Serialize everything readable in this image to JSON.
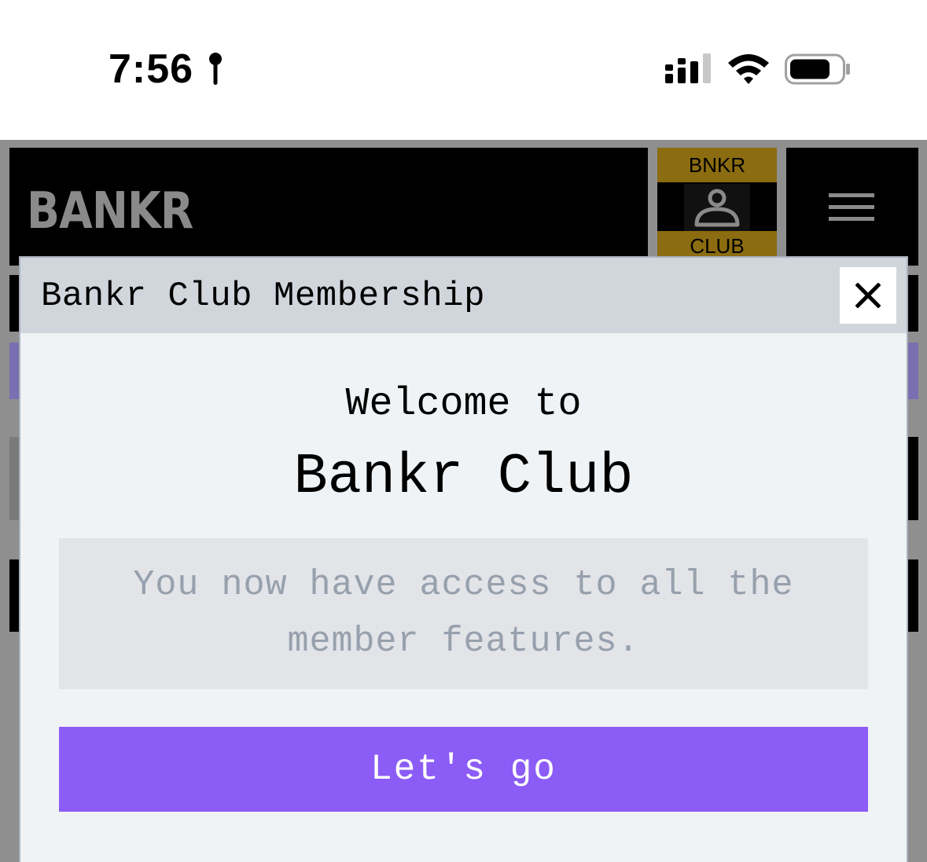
{
  "status_bar": {
    "time": "7:56",
    "icons": [
      "location-icon",
      "signal-icon",
      "wifi-icon",
      "battery-icon"
    ]
  },
  "header": {
    "brand": "BANKR",
    "badge": {
      "top": "BNKR",
      "bottom": "CLUB",
      "icon": "user-icon"
    },
    "menu_icon": "hamburger-menu-icon"
  },
  "modal": {
    "title": "Bankr Club Membership",
    "close_icon": "close-icon",
    "welcome": "Welcome to",
    "club_name": "Bankr Club",
    "message": "You now have access to all the member features.",
    "cta": "Let's go"
  },
  "colors": {
    "accent": "#8b5cf6",
    "badge_gold": "#8b6c10",
    "modal_bg": "#f0f3f5",
    "modal_header": "#d1d5dc",
    "info_text": "#97a0ad"
  }
}
